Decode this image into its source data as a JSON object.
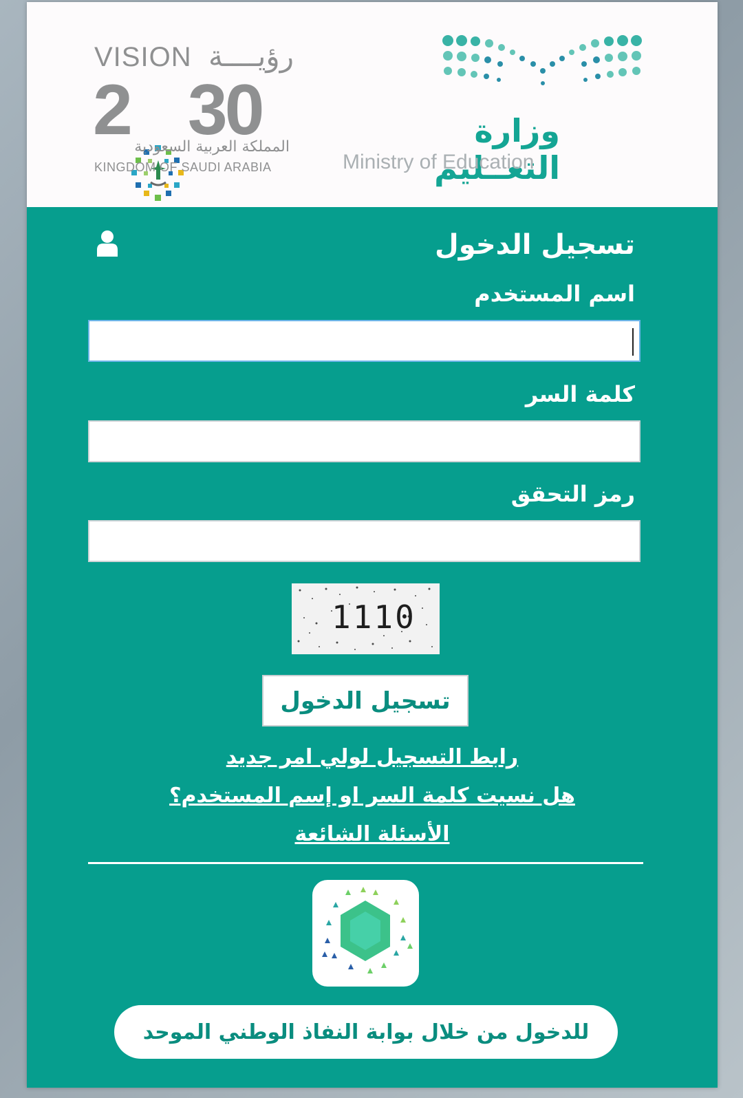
{
  "header": {
    "vision_word": "VISION",
    "vision_ar": "رؤيــــة",
    "vision_year_left": "2",
    "vision_year_right": "30",
    "vision_ksa_ar": "المملكة العربية السعودية",
    "vision_ksa_en": "KINGDOM OF SAUDI ARABIA",
    "ministry_ar": "وزارة التعــليم",
    "ministry_en": "Ministry of Education"
  },
  "form": {
    "title": "تسجيل الدخول",
    "username_label": "اسم المستخدم",
    "username_value": "",
    "password_label": "كلمة السر",
    "password_value": "",
    "captcha_label": "رمز التحقق",
    "captcha_value": "",
    "captcha_code": "1110",
    "submit_label": "تسجيل الدخول"
  },
  "links": {
    "guardian_register": "رابط التسجيل لولي امر جديد",
    "forgot": "هل نسيت كلمة السر او إسم المستخدم؟",
    "faq": "الأسئلة الشائعة"
  },
  "nafath": {
    "button_label": "للدخول من خلال بوابة النفاذ الوطني الموحد"
  },
  "icons": [
    "user-icon",
    "vision-2030-logo",
    "ministry-logo",
    "nafath-logo"
  ],
  "colors": {
    "primary": "#069e8e",
    "header_bg": "#fdfbfc",
    "logo_teal": "#14a594",
    "logo_gray": "#8f9091"
  }
}
